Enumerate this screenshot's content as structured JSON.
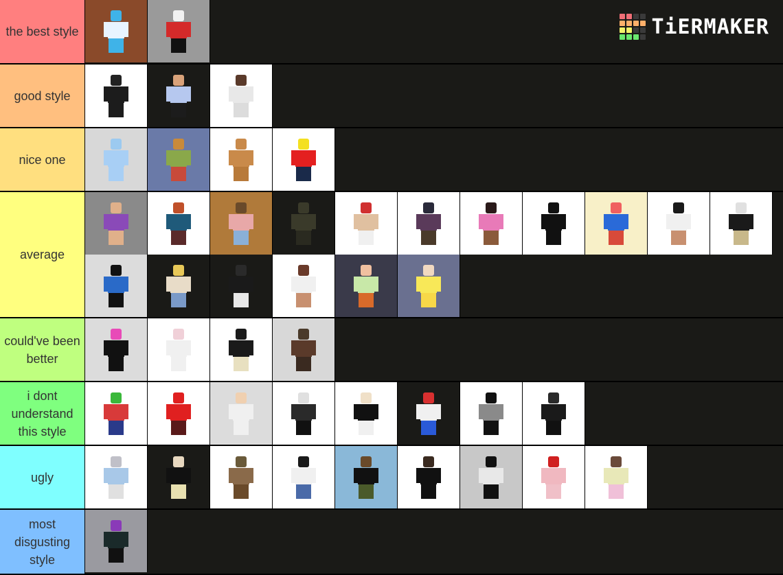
{
  "app": {
    "brand": "TiERMAKER",
    "logo_grid": [
      "#f06e76",
      "#f06e76",
      "#3a3a3a",
      "#3a3a3a",
      "#ffb06a",
      "#ffb06a",
      "#ffb06a",
      "#ffb06a",
      "#f4f36a",
      "#f4f36a",
      "#3a3a3a",
      "#3a3a3a",
      "#6ae86e",
      "#6ae86e",
      "#6ae86e",
      "#3a3a3a"
    ]
  },
  "tiers": [
    {
      "label": "the best style",
      "color": "#ff7f7f",
      "items": [
        {
          "name": "furry-duo-avatar",
          "bg": "#8a4a2a",
          "head": "#3fb3e8",
          "torso": "#e8f4ff",
          "legs": "#3fb3e8"
        },
        {
          "name": "red-star-shirt-avatar",
          "bg": "#9a9a9a",
          "head": "#f2f2f2",
          "torso": "#d42a2a",
          "legs": "#111111"
        }
      ]
    },
    {
      "label": "good style",
      "color": "#ffbf7f",
      "items": [
        {
          "name": "black-tactical-avatar",
          "bg": "#ffffff",
          "head": "#222222",
          "torso": "#1c1c1c",
          "legs": "#1c1c1c"
        },
        {
          "name": "blue-hair-hoodie-avatar",
          "bg": "#1a1a17",
          "head": "#d9a27a",
          "torso": "#b6c8ef",
          "legs": "#1c1c1c"
        },
        {
          "name": "suit-avatar",
          "bg": "#ffffff",
          "head": "#5a3a2a",
          "torso": "#e8e8e8",
          "legs": "#dcdcdc"
        }
      ]
    },
    {
      "label": "nice one",
      "color": "#ffdf7f",
      "items": [
        {
          "name": "antler-ice-avatar",
          "bg": "#d8d8d8",
          "head": "#9ccaf0",
          "torso": "#a8cff5",
          "legs": "#a8cff5"
        },
        {
          "name": "burger-avatar",
          "bg": "#6a7aa8",
          "head": "#c98a3a",
          "torso": "#8aa84a",
          "legs": "#c84a3a"
        },
        {
          "name": "cat-head-avatar",
          "bg": "#ffffff",
          "head": "#c98a4a",
          "torso": "#c98a4a",
          "legs": "#b87a3a"
        },
        {
          "name": "classic-noob-avatar",
          "bg": "#ffffff",
          "head": "#f4e020",
          "torso": "#e42020",
          "legs": "#1a2a4a"
        }
      ]
    },
    {
      "label": "average",
      "color": "#ffff7f",
      "items": [
        {
          "name": "ariana-avatar",
          "bg": "#8a8a8a",
          "head": "#e0b08a",
          "torso": "#8a4ab8",
          "legs": "#e0b08a"
        },
        {
          "name": "red-hair-jacket-avatar",
          "bg": "#ffffff",
          "head": "#c0502a",
          "torso": "#1f5a7a",
          "legs": "#5a2a2a"
        },
        {
          "name": "goggles-room-avatar",
          "bg": "#b07a3a",
          "head": "#6a4a2a",
          "torso": "#e8a8a8",
          "legs": "#8ab0d8"
        },
        {
          "name": "soldier-avatar",
          "bg": "#1a1a17",
          "head": "#3a3a2a",
          "torso": "#3a3a2a",
          "legs": "#2a2a20"
        },
        {
          "name": "mushroom-hat-avatar",
          "bg": "#ffffff",
          "head": "#d03030",
          "torso": "#e0c0a0",
          "legs": "#f0f0f0"
        },
        {
          "name": "purple-cat-avatar",
          "bg": "#ffffff",
          "head": "#2a2a3a",
          "torso": "#5a3a5a",
          "legs": "#4a3a2a"
        },
        {
          "name": "pink-visor-avatar",
          "bg": "#ffffff",
          "head": "#2a1a1a",
          "torso": "#e87ab8",
          "legs": "#8a5a3a"
        },
        {
          "name": "black-outfit-avatar",
          "bg": "#ffffff",
          "head": "#111111",
          "torso": "#111111",
          "legs": "#111111"
        },
        {
          "name": "clown-avatar",
          "bg": "#f8f0c8",
          "head": "#f06060",
          "torso": "#2a6ad8",
          "legs": "#d84a3a"
        },
        {
          "name": "white-top-avatar",
          "bg": "#ffffff",
          "head": "#1a1a1a",
          "torso": "#f0f0f0",
          "legs": "#c89070"
        },
        {
          "name": "dark-wings-avatar",
          "bg": "#ffffff",
          "head": "#e0e0e0",
          "torso": "#1a1a1a",
          "legs": "#c8b88a"
        },
        {
          "name": "emo-blue-shirt-avatar",
          "bg": "#dcdcdc",
          "head": "#111111",
          "torso": "#2a6ac8",
          "legs": "#111111"
        },
        {
          "name": "blonde-sweater-avatar",
          "bg": "#1a1a17",
          "head": "#e8c858",
          "torso": "#e8dcc8",
          "legs": "#7a9ac8"
        },
        {
          "name": "neon-wings-avatar",
          "bg": "#1a1a17",
          "head": "#2a2a2a",
          "torso": "#1a1a1a",
          "legs": "#e8e8e8"
        },
        {
          "name": "brunette-white-top-avatar",
          "bg": "#ffffff",
          "head": "#6a3a2a",
          "torso": "#f0f0f0",
          "legs": "#c89070"
        },
        {
          "name": "tie-dye-avatar",
          "bg": "#3a3a4a",
          "head": "#f0c0a0",
          "torso": "#c8e8a8",
          "legs": "#d86a2a"
        },
        {
          "name": "yellow-skirt-avatar",
          "bg": "#6a7090",
          "head": "#f0d8c0",
          "torso": "#f8e858",
          "legs": "#f8d848"
        }
      ]
    },
    {
      "label": "could've been better",
      "color": "#bfff7f",
      "items": [
        {
          "name": "rainbow-hair-avatar",
          "bg": "#dcdcdc",
          "head": "#e84ab8",
          "torso": "#111111",
          "legs": "#111111"
        },
        {
          "name": "bear-hood-avatar",
          "bg": "#ffffff",
          "head": "#f0d0d8",
          "torso": "#f0f0f0",
          "legs": "#f0f0f0"
        },
        {
          "name": "teddy-bear-avatar",
          "bg": "#ffffff",
          "head": "#1a1a1a",
          "torso": "#1a1a1a",
          "legs": "#e8e0c0"
        },
        {
          "name": "brown-wings-avatar",
          "bg": "#d8d8d8",
          "head": "#4a3a2a",
          "torso": "#5a3a2a",
          "legs": "#3a2a20"
        }
      ]
    },
    {
      "label": "i dont understand this style",
      "color": "#7fff7f",
      "items": [
        {
          "name": "mario-luigi-avatar",
          "bg": "#ffffff",
          "head": "#3ab83a",
          "torso": "#d83a3a",
          "legs": "#2a3a8a"
        },
        {
          "name": "red-coke-avatar",
          "bg": "#ffffff",
          "head": "#e02020",
          "torso": "#e02020",
          "legs": "#5a1a1a"
        },
        {
          "name": "cookie-avatar",
          "bg": "#dcdcdc",
          "head": "#f0d0b0",
          "torso": "#f0f0f0",
          "legs": "#f0f0f0"
        },
        {
          "name": "dark-horn-avatar",
          "bg": "#ffffff",
          "head": "#e0e0e0",
          "torso": "#2a2a2a",
          "legs": "#111111"
        },
        {
          "name": "black-dress-avatar",
          "bg": "#ffffff",
          "head": "#f0e0c8",
          "torso": "#111111",
          "legs": "#f0f0f0"
        },
        {
          "name": "red-cap-avatar",
          "bg": "#1a1a17",
          "head": "#d83030",
          "torso": "#f0f0f0",
          "legs": "#2a5ad8"
        },
        {
          "name": "grey-hoodie-avatar",
          "bg": "#ffffff",
          "head": "#111111",
          "torso": "#8a8a8a",
          "legs": "#111111"
        },
        {
          "name": "military-hat-avatar",
          "bg": "#ffffff",
          "head": "#2a2a2a",
          "torso": "#1a1a1a",
          "legs": "#111111"
        }
      ]
    },
    {
      "label": "ugly",
      "color": "#7fffff",
      "items": [
        {
          "name": "grey-cat-hood-avatar",
          "bg": "#ffffff",
          "head": "#c0c0c8",
          "torso": "#a8c8e8",
          "legs": "#e0e0e0"
        },
        {
          "name": "maid-avatar",
          "bg": "#1a1a17",
          "head": "#e8d8c0",
          "torso": "#111111",
          "legs": "#e8e0b0"
        },
        {
          "name": "camo-helmet-avatar",
          "bg": "#ffffff",
          "head": "#6a5a3a",
          "torso": "#8a6a4a",
          "legs": "#6a4a2a"
        },
        {
          "name": "crop-top-jeans-avatar",
          "bg": "#ffffff",
          "head": "#1a1a1a",
          "torso": "#f0f0f0",
          "legs": "#4a6aa8"
        },
        {
          "name": "baseplate-camo-avatar",
          "bg": "#8ab8d8",
          "head": "#6a4a2a",
          "torso": "#111111",
          "legs": "#4a5a2a"
        },
        {
          "name": "red-logo-black-avatar",
          "bg": "#ffffff",
          "head": "#3a2a20",
          "torso": "#111111",
          "legs": "#111111"
        },
        {
          "name": "tv-head-avatar",
          "bg": "#c8c8c8",
          "head": "#111111",
          "torso": "#e8e8e8",
          "legs": "#111111"
        },
        {
          "name": "red-hair-kimono-avatar",
          "bg": "#ffffff",
          "head": "#d02020",
          "torso": "#f0b8c0",
          "legs": "#f0c0c8"
        },
        {
          "name": "pigtails-pastel-avatar",
          "bg": "#ffffff",
          "head": "#6a4a3a",
          "torso": "#e8e8b8",
          "legs": "#f0c0d8"
        }
      ]
    },
    {
      "label": "most disgusting style",
      "color": "#7fbfff",
      "items": [
        {
          "name": "cat-ears-baseplate-avatar",
          "bg": "#9a9aa0",
          "head": "#8a3ab8",
          "torso": "#1a2a2a",
          "legs": "#111111"
        }
      ]
    }
  ]
}
